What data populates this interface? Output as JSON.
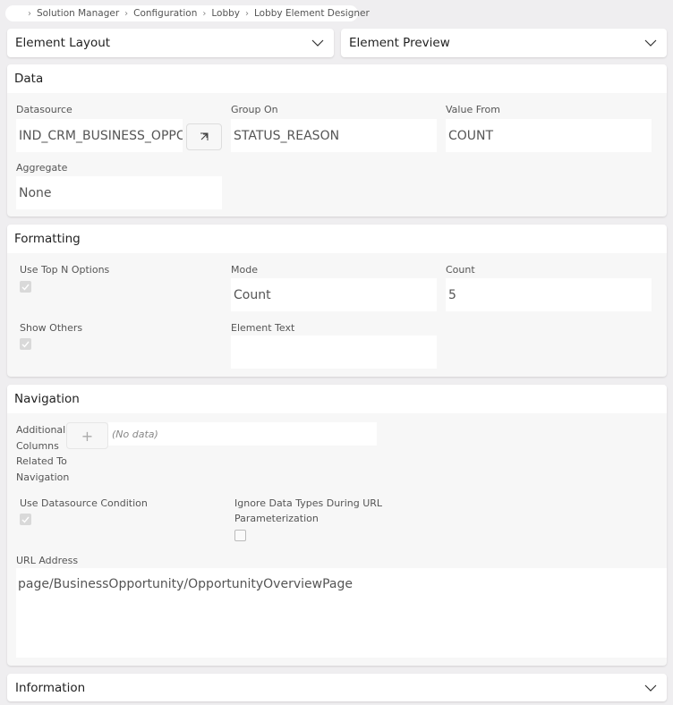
{
  "breadcrumb": {
    "home_icon": "blue-dot-icon",
    "items": [
      "Solution Manager",
      "Configuration",
      "Lobby",
      "Lobby Element Designer"
    ]
  },
  "element_layout": {
    "label": "Element Layout",
    "icon": "chevron-down-icon"
  },
  "element_preview": {
    "label": "Element Preview",
    "icon": "chevron-down-icon"
  },
  "data_section": {
    "title": "Data",
    "datasource": {
      "label": "Datasource",
      "value": "IND_CRM_BUSINESS_OPPC",
      "button_icon": "open-link-icon"
    },
    "group_on": {
      "label": "Group On",
      "value": "STATUS_REASON"
    },
    "value_from": {
      "label": "Value From",
      "value": "COUNT"
    },
    "aggregate": {
      "label": "Aggregate",
      "value": "None"
    }
  },
  "formatting_section": {
    "title": "Formatting",
    "use_top_n": {
      "label": "Use Top N Options",
      "checked": true
    },
    "mode": {
      "label": "Mode",
      "value": "Count"
    },
    "count": {
      "label": "Count",
      "value": "5"
    },
    "show_others": {
      "label": "Show Others",
      "checked": true
    },
    "element_text": {
      "label": "Element Text",
      "value": ""
    }
  },
  "navigation_section": {
    "title": "Navigation",
    "additional_columns": {
      "label_lines": [
        "Additional",
        "Columns",
        "Related To",
        "Navigation"
      ],
      "add_icon": "plus-icon",
      "empty_text": "(No data)"
    },
    "use_datasource_condition": {
      "label": "Use Datasource Condition",
      "checked": true
    },
    "ignore_data_types": {
      "label_lines": [
        "Ignore Data Types During URL",
        "Parameterization"
      ],
      "checked": false
    },
    "url_address": {
      "label": "URL Address",
      "value": "page/BusinessOpportunity/OpportunityOverviewPage"
    }
  },
  "information_section": {
    "title": "Information",
    "icon": "chevron-down-icon"
  },
  "colors": {
    "accent": "#0b6cd6",
    "background": "#efeef0",
    "panel": "#f7f7f7"
  }
}
